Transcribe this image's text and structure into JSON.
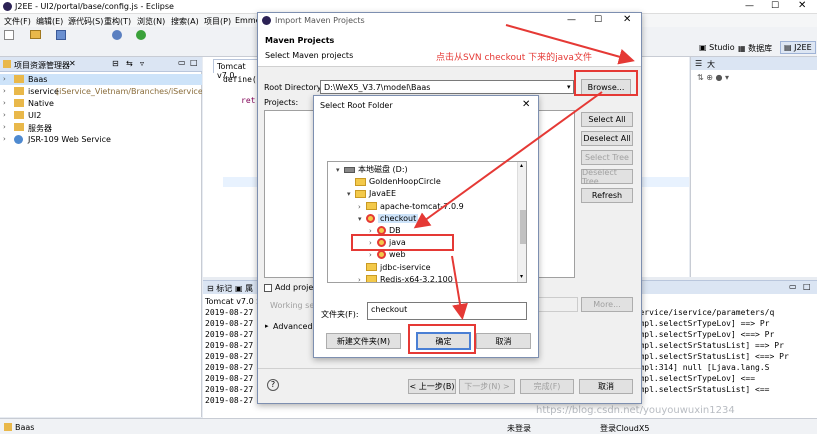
{
  "eclipse": {
    "title": "J2EE - UI2/portal/base/config.js - Eclipse",
    "menu": [
      "文件(F)",
      "编辑(E)",
      "源代码(S)",
      "重构(T)",
      "浏览(N)",
      "搜索(A)",
      "项目(P)",
      "Emme"
    ],
    "perspectives": [
      "Studio",
      "数据库",
      "J2EE"
    ],
    "explorer_title": "项目资源管理器",
    "explorer_items": [
      {
        "label": "Baas",
        "suffix": ""
      },
      {
        "label": "iservice",
        "suffix": "[iService_Vietnam/Branches/iService_Viet"
      },
      {
        "label": "Native",
        "suffix": ""
      },
      {
        "label": "UI2",
        "suffix": ""
      },
      {
        "label": "服务器",
        "suffix": ""
      },
      {
        "label": "JSR-109 Web Service",
        "suffix": ""
      }
    ],
    "editor_tab": "Tomcat v7.0",
    "editor_lines": [
      "define(",
      "ret"
    ],
    "right_panel_title": "大",
    "bottom_tabs": [
      "标记",
      "属"
    ],
    "console_header": "Tomcat v7.0 Se",
    "console_dates": [
      "2019-08-27",
      "2019-08-27",
      "2019-08-27",
      "2019-08-27",
      "2019-08-27",
      "2019-08-27",
      "2019-08-27",
      "2019-08-27",
      "2019-08-27"
    ],
    "console_right": [
      "/iservice/iservice/parameters/q",
      "ceImpl.selectSrTypeLov] ==>  Pr",
      "ceImpl.selectSrTypeLov] <==>  Pr",
      "ceImpl.selectSrStatusList] ==>  Pr",
      "ceImpl.selectSrStatusList] <==>  Pr",
      "ceImpl:314] null  [Ljava.lang.S",
      "ceImpl.selectSrTypeLov] <==",
      "ceImpl.selectSrStatusList] <=="
    ],
    "status_left": "Baas",
    "status_mid": "未登录",
    "status_right": "登录CloudX5",
    "watermark": "https://blog.csdn.net/youyouwuxin1234"
  },
  "maven_dialog": {
    "title": "Import Maven Projects",
    "heading": "Maven Projects",
    "subheading": "Select Maven projects",
    "annotation": "点击从SVN checkout 下来的java文件",
    "root_label": "Root Directory:",
    "root_value": "D:\\WeX5_V3.7\\model\\Baas",
    "browse": "Browse...",
    "projects_label": "Projects:",
    "select_all": "Select All",
    "deselect_all": "Deselect All",
    "select_tree": "Select Tree",
    "deselect_tree": "Deselect Tree",
    "refresh": "Refresh",
    "add_project": "Add project",
    "working_set": "Working set",
    "more": "More...",
    "advanced": "Advanced",
    "back": "< 上一步(B)",
    "next": "下一步(N) >",
    "finish": "完成(F)",
    "cancel": "取消"
  },
  "folder_dialog": {
    "title": "Select Root Folder",
    "tree": [
      {
        "label": "本地磁盘 (D:)",
        "icon": "drive-icon",
        "indent": 0,
        "arrow": "▾"
      },
      {
        "label": "GoldenHoopCircle",
        "icon": "folder-icon",
        "indent": 1,
        "arrow": ""
      },
      {
        "label": "JavaEE",
        "icon": "folder-icon",
        "indent": 1,
        "arrow": "▾"
      },
      {
        "label": "apache-tomcat-7.0.9",
        "icon": "folder-icon",
        "indent": 2,
        "arrow": "›"
      },
      {
        "label": "checkout",
        "icon": "svn-folder-icon",
        "indent": 2,
        "arrow": "▾"
      },
      {
        "label": "DB",
        "icon": "svn-folder-icon",
        "indent": 3,
        "arrow": "›"
      },
      {
        "label": "java",
        "icon": "svn-folder-icon",
        "indent": 3,
        "arrow": "›"
      },
      {
        "label": "web",
        "icon": "svn-folder-icon",
        "indent": 3,
        "arrow": "›"
      },
      {
        "label": "jdbc-iservice",
        "icon": "folder-icon",
        "indent": 2,
        "arrow": ""
      },
      {
        "label": "Redis-x64-3.2.100",
        "icon": "folder-icon",
        "indent": 2,
        "arrow": "›"
      },
      {
        "label": "WeX5文件",
        "icon": "folder-icon",
        "indent": 2,
        "arrow": "›"
      }
    ],
    "folder_label": "文件夹(F):",
    "folder_value": "checkout",
    "new_folder": "新建文件夹(M)",
    "ok": "确定",
    "cancel": "取消"
  }
}
